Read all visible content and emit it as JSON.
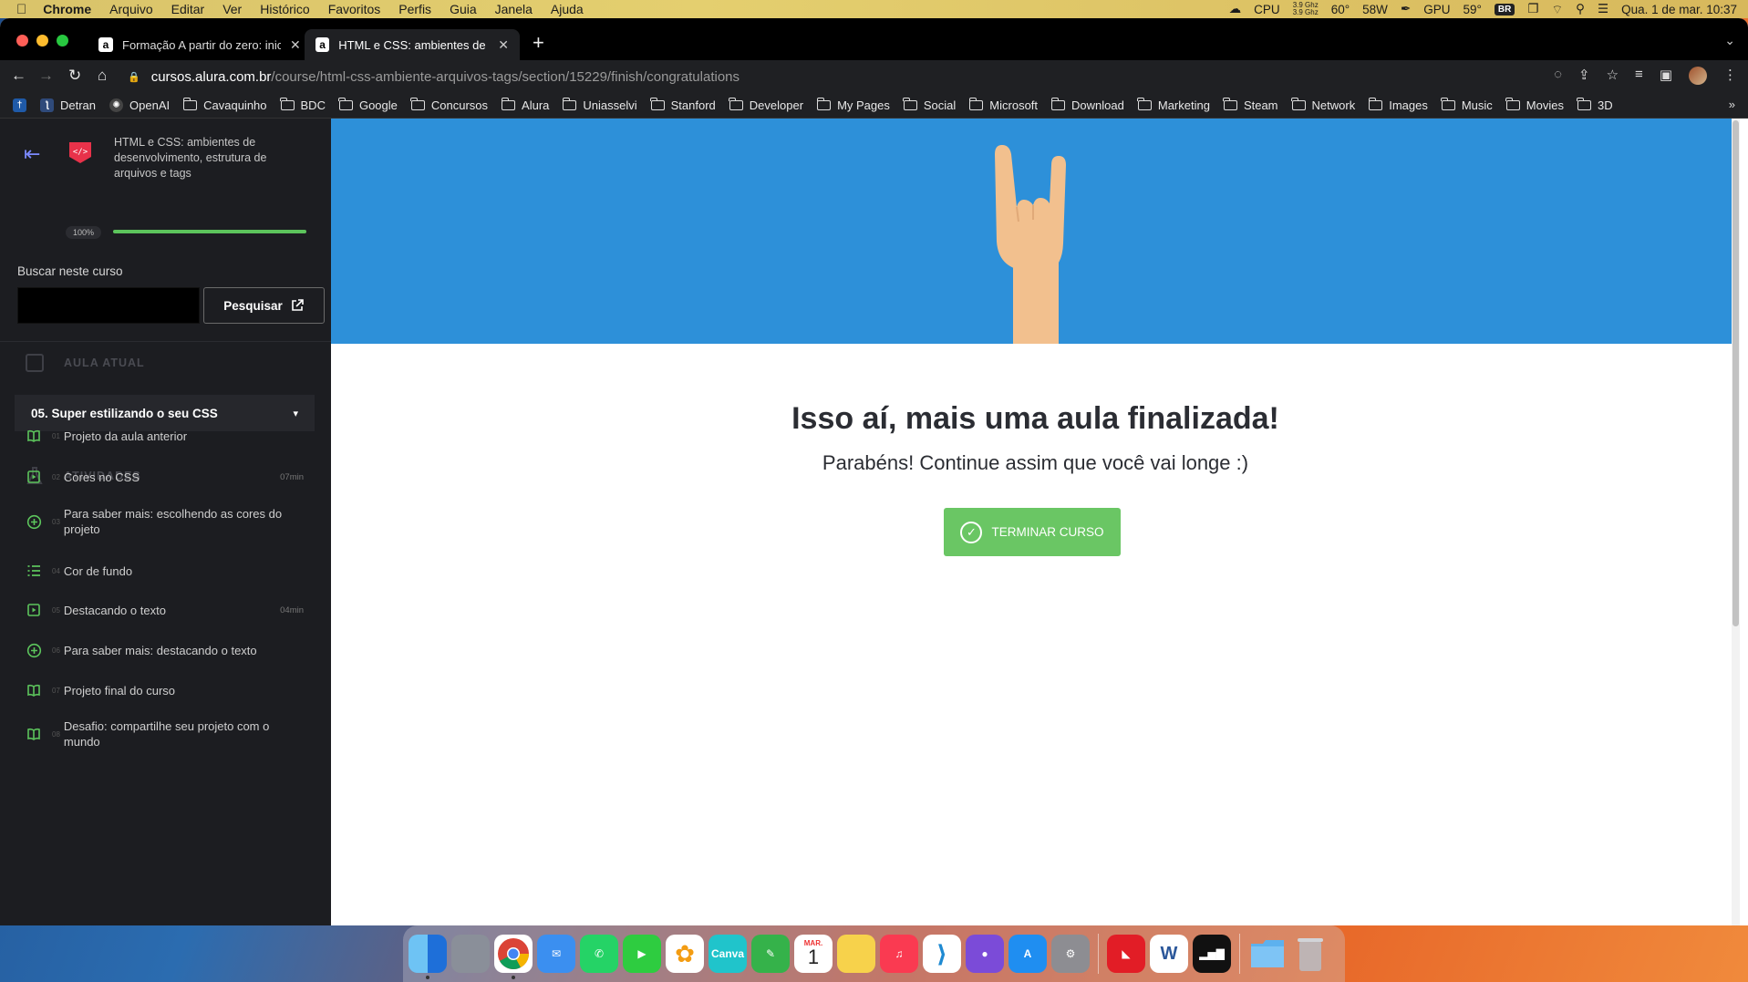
{
  "menubar": {
    "app": "Chrome",
    "items": [
      "Arquivo",
      "Editar",
      "Ver",
      "Histórico",
      "Favoritos",
      "Perfis",
      "Guia",
      "Janela",
      "Ajuda"
    ],
    "status": {
      "cpu_label": "CPU",
      "cpu_freq_top": "3.9 Ghz",
      "cpu_freq_bottom": "3.9 Ghz",
      "cpu_temp": "60°",
      "power": "58W",
      "gpu_label": "GPU",
      "gpu_temp": "59°",
      "input_source": "BR",
      "datetime": "Qua. 1 de mar.  10:37"
    }
  },
  "browser": {
    "tabs": [
      {
        "title": "Formação A partir do zero: inic",
        "favicon": "a",
        "active": false
      },
      {
        "title": "HTML e CSS: ambientes de de",
        "favicon": "a",
        "active": true
      }
    ],
    "url_host": "cursos.alura.com.br",
    "url_path": "/course/html-css-ambiente-arquivos-tags/section/15229/finish/congratulations",
    "bookmarks": [
      {
        "label": "Detran",
        "type": "site",
        "color": "#2f4a7a"
      },
      {
        "label": "OpenAI",
        "type": "site",
        "color": "#444"
      },
      {
        "label": "Cavaquinho",
        "type": "folder"
      },
      {
        "label": "BDC",
        "type": "folder"
      },
      {
        "label": "Google",
        "type": "folder"
      },
      {
        "label": "Concursos",
        "type": "folder"
      },
      {
        "label": "Alura",
        "type": "folder"
      },
      {
        "label": "Uniasselvi",
        "type": "folder"
      },
      {
        "label": "Stanford",
        "type": "folder"
      },
      {
        "label": "Developer",
        "type": "folder"
      },
      {
        "label": "My Pages",
        "type": "folder"
      },
      {
        "label": "Social",
        "type": "folder"
      },
      {
        "label": "Microsoft",
        "type": "folder"
      },
      {
        "label": "Download",
        "type": "folder"
      },
      {
        "label": "Marketing",
        "type": "folder"
      },
      {
        "label": "Steam",
        "type": "folder"
      },
      {
        "label": "Network",
        "type": "folder"
      },
      {
        "label": "Images",
        "type": "folder"
      },
      {
        "label": "Music",
        "type": "folder"
      },
      {
        "label": "Movies",
        "type": "folder"
      },
      {
        "label": "3D",
        "type": "folder"
      }
    ]
  },
  "sidebar": {
    "course_title": "HTML e CSS: ambientes de desenvolvimento, estrutura de arquivos e tags",
    "progress_label": "100%",
    "progress": 1.0,
    "search_label": "Buscar neste curso",
    "search_value": "",
    "search_button": "Pesquisar",
    "current_section_header": "AULA ATUAL",
    "current_lesson": "05. Super estilizando o seu CSS",
    "activities_header": "ATIVIDADES",
    "activities": [
      {
        "num": "01",
        "label": "Projeto da aula anterior",
        "duration": "",
        "icon": "book-icon"
      },
      {
        "num": "02",
        "label": "Cores no CSS",
        "duration": "07min",
        "icon": "video-icon"
      },
      {
        "num": "03",
        "label": "Para saber mais: escolhendo as cores do projeto",
        "duration": "",
        "icon": "plus-circle-icon"
      },
      {
        "num": "04",
        "label": "Cor de fundo",
        "duration": "",
        "icon": "list-icon"
      },
      {
        "num": "05",
        "label": "Destacando o texto",
        "duration": "04min",
        "icon": "video-icon"
      },
      {
        "num": "06",
        "label": "Para saber mais: destacando o texto",
        "duration": "",
        "icon": "plus-circle-icon"
      },
      {
        "num": "07",
        "label": "Projeto final do curso",
        "duration": "",
        "icon": "book-icon"
      },
      {
        "num": "08",
        "label": "Desafio: compartilhe seu projeto com o mundo",
        "duration": "",
        "icon": "book-icon"
      }
    ]
  },
  "main": {
    "headline": "Isso aí, mais uma aula finalizada!",
    "subline": "Parabéns! Continue assim que você vai longe :)",
    "finish_button": "TERMINAR CURSO"
  },
  "colors": {
    "hero_bg": "#2d90d9",
    "accent_green": "#6ac664",
    "sidebar_bg": "#1c1d21",
    "progress_green": "#5cc45c"
  },
  "dock": {
    "apps": [
      {
        "name": "finder-icon",
        "color": "#3a8ee6",
        "glyph": ""
      },
      {
        "name": "launchpad-icon",
        "color": "#8a8f99",
        "glyph": ""
      },
      {
        "name": "chrome-icon",
        "color": "#ffffff",
        "glyph": ""
      },
      {
        "name": "mail-icon",
        "color": "#3b8ff0",
        "glyph": "✉"
      },
      {
        "name": "whatsapp-icon",
        "color": "#25d366",
        "glyph": "✆"
      },
      {
        "name": "facetime-icon",
        "color": "#2ecc40",
        "glyph": "▶"
      },
      {
        "name": "photos-icon",
        "color": "#ffffff",
        "glyph": "✿"
      },
      {
        "name": "canva-icon",
        "color": "#20c4cb",
        "glyph": "Canva"
      },
      {
        "name": "pen-app-icon",
        "color": "#35b24a",
        "glyph": "✎"
      },
      {
        "name": "calendar-icon",
        "color": "#ffffff",
        "glyph": "1"
      },
      {
        "name": "notes-icon",
        "color": "#f7d24b",
        "glyph": ""
      },
      {
        "name": "music-icon",
        "color": "#fa3a51",
        "glyph": "♫"
      },
      {
        "name": "vscode-icon",
        "color": "#ffffff",
        "glyph": "⟩"
      },
      {
        "name": "github-icon",
        "color": "#7b4bd8",
        "glyph": "●"
      },
      {
        "name": "app-store-icon",
        "color": "#1f8ef1",
        "glyph": "A"
      },
      {
        "name": "system-settings-icon",
        "color": "#8d8d92",
        "glyph": "⚙"
      },
      {
        "name": "amd-icon",
        "color": "#e21d26",
        "glyph": "◣"
      },
      {
        "name": "word-icon",
        "color": "#ffffff",
        "glyph": "W"
      },
      {
        "name": "activity-monitor-icon",
        "color": "#111111",
        "glyph": "▂▅▇"
      },
      {
        "name": "folder-icon",
        "color": "#5db1ee",
        "glyph": ""
      },
      {
        "name": "trash-icon",
        "color": "#9aa0a6",
        "glyph": ""
      }
    ],
    "calendar_month": "MAR.",
    "calendar_day": "1"
  }
}
